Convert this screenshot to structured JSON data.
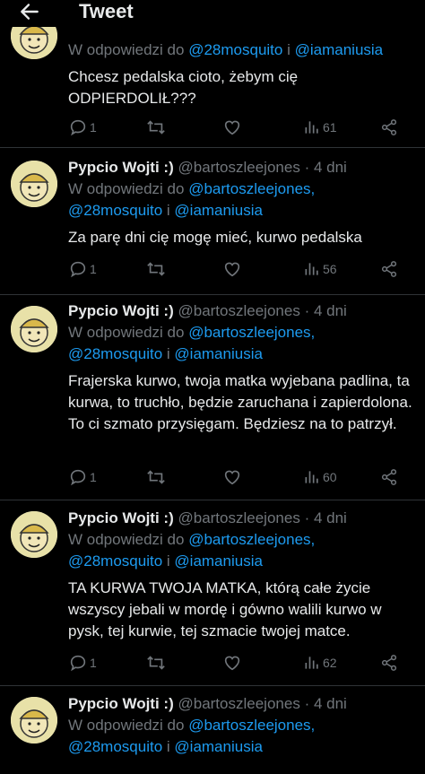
{
  "header": {
    "title": "Tweet"
  },
  "reply_prefix": "W odpowiedzi do",
  "conj": "i",
  "tweets": [
    {
      "partial": true,
      "mentions": [
        "@28mosquito",
        "@iamaniusia"
      ],
      "text": "Chcesz pedalska cioto, żebym cię ODPIERDOLIŁ???",
      "replies": "1",
      "retweets": "",
      "views": "61"
    },
    {
      "name": "Pypcio Wojti :)",
      "handle": "@bartoszleejones",
      "sep": "·",
      "time": "4 dni",
      "mentions": [
        "@bartoszleejones,",
        "@28mosquito",
        "@iamaniusia"
      ],
      "text": "Za parę dni cię mogę mieć, kurwo pedalska",
      "replies": "1",
      "retweets": "",
      "views": "56"
    },
    {
      "name": "Pypcio Wojti :)",
      "handle": "@bartoszleejones",
      "sep": "·",
      "time": "4 dni",
      "mentions": [
        "@bartoszleejones,",
        "@28mosquito",
        "@iamaniusia"
      ],
      "text": "Frajerska kurwo, twoja matka wyjebana padlina, ta kurwa, to truchło, będzie zaruchana i zapierdolona. To ci szmato przysięgam. Będziesz na to patrzył.",
      "replies": "1",
      "retweets": "",
      "views": "60"
    },
    {
      "name": "Pypcio Wojti :)",
      "handle": "@bartoszleejones",
      "sep": "·",
      "time": "4 dni",
      "mentions": [
        "@bartoszleejones,",
        "@28mosquito",
        "@iamaniusia"
      ],
      "text": "TA KURWA TWOJA MATKA, którą całe życie wszyscy jebali w mordę i gówno walili kurwo w pysk, tej kurwie, tej szmacie twojej matce.",
      "replies": "1",
      "retweets": "",
      "views": "62"
    },
    {
      "name": "Pypcio Wojti :)",
      "handle": "@bartoszleejones",
      "sep": "·",
      "time": "4 dni",
      "mentions": [
        "@bartoszleejones,",
        "@28mosquito",
        "@iamaniusia"
      ]
    }
  ],
  "icons": {
    "reply": "reply-icon",
    "retweet": "retweet-icon",
    "like": "heart-icon",
    "views": "views-icon",
    "share": "share-icon"
  }
}
